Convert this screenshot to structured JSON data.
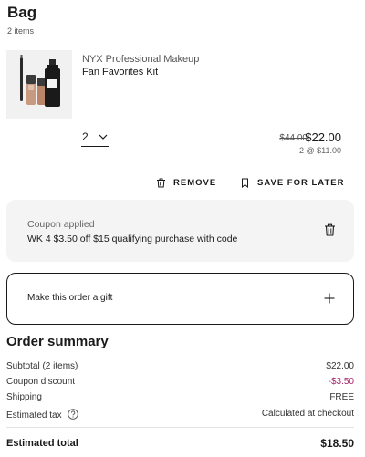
{
  "bag": {
    "title": "Bag",
    "item_count": "2 items"
  },
  "item": {
    "brand": "NYX Professional Makeup",
    "name": "Fan Favorites Kit",
    "quantity": "2",
    "original_price": "$44.00",
    "price": "$22.00",
    "unit_price": "2 @ $11.00"
  },
  "actions": {
    "remove": "REMOVE",
    "save_for_later": "SAVE FOR LATER"
  },
  "coupon": {
    "label": "Coupon applied",
    "description": "WK 4 $3.50 off $15 qualifying purchase with code"
  },
  "gift": {
    "label": "Make this order a gift"
  },
  "summary": {
    "title": "Order summary",
    "subtotal_label": "Subtotal (2 items)",
    "subtotal_value": "$22.00",
    "coupon_label": "Coupon discount",
    "coupon_value": "-$3.50",
    "shipping_label": "Shipping",
    "shipping_value": "FREE",
    "tax_label": "Estimated tax",
    "tax_value": "Calculated at checkout",
    "total_label": "Estimated total",
    "total_value": "$18.50"
  },
  "colors": {
    "discount": "#a5246a",
    "card_background": "#f4f4f4"
  },
  "icons": {
    "quantity": "chevron-down-icon",
    "remove": "trash-icon",
    "save_for_later": "bookmark-icon",
    "coupon_remove": "trash-icon",
    "gift": "plus-icon",
    "tax_help": "question-circle-icon"
  }
}
